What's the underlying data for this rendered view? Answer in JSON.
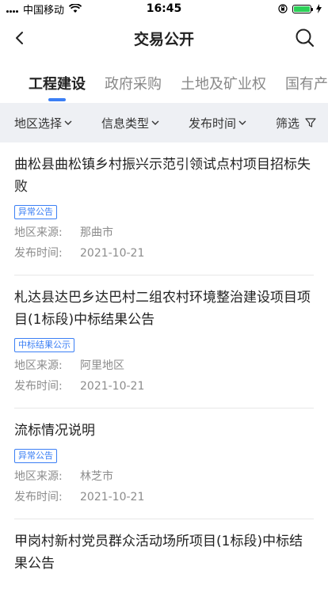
{
  "status": {
    "carrier": "中国移动",
    "time": "16:45"
  },
  "nav": {
    "title": "交易公开"
  },
  "tabs": [
    {
      "label": "工程建设",
      "active": true
    },
    {
      "label": "政府采购",
      "active": false
    },
    {
      "label": "土地及矿业权",
      "active": false
    },
    {
      "label": "国有产",
      "active": false
    }
  ],
  "filters": {
    "region": "地区选择",
    "info_type": "信息类型",
    "publish_time": "发布时间",
    "screen": "筛选"
  },
  "list": {
    "region_label": "地区来源:",
    "date_label": "发布时间:",
    "items": [
      {
        "title": "曲松县曲松镇乡村振兴示范引领试点村项目招标失败",
        "badge": "异常公告",
        "region": "那曲市",
        "date": "2021-10-21"
      },
      {
        "title": "札达县达巴乡达巴村二组农村环境整治建设项目项目(1标段)中标结果公告",
        "badge": "中标结果公示",
        "region": "阿里地区",
        "date": "2021-10-21"
      },
      {
        "title": "流标情况说明",
        "badge": "异常公告",
        "region": "林芝市",
        "date": "2021-10-21"
      },
      {
        "title": "甲岗村新村党员群众活动场所项目(1标段)中标结果公告",
        "badge": "",
        "region": "",
        "date": ""
      }
    ]
  },
  "colors": {
    "accent": "#3b7ff5",
    "filter_bg": "#eef0f4",
    "battery": "#2bd157"
  }
}
